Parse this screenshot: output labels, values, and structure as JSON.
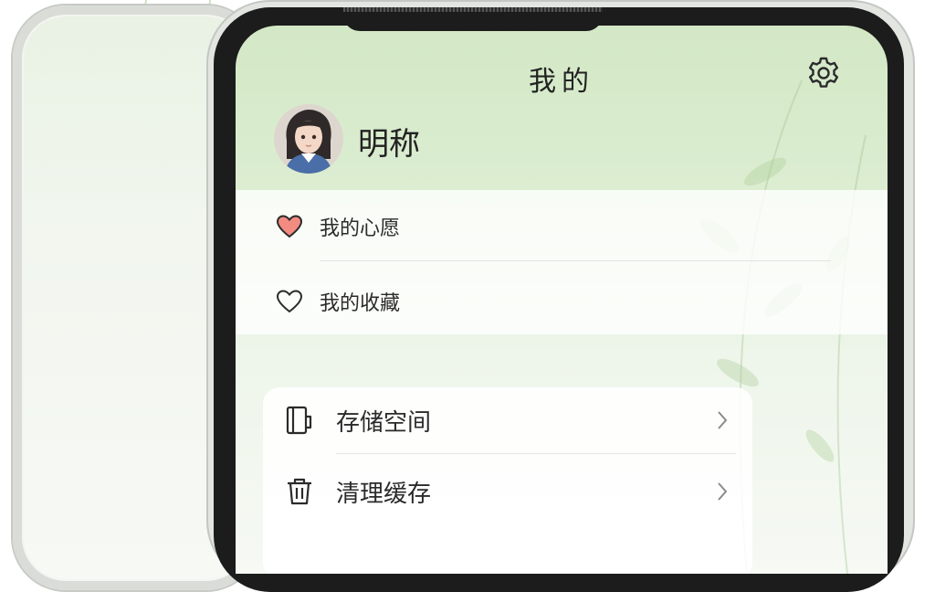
{
  "header": {
    "title": "我的",
    "settings_icon": "gear-icon"
  },
  "profile": {
    "name": "明称",
    "avatar": "avatar"
  },
  "menu": {
    "items": [
      {
        "label": "我的心愿",
        "icon": "heart-filled-icon",
        "color": "#f28b82"
      },
      {
        "label": "我的收藏",
        "icon": "heart-outline-icon"
      }
    ]
  },
  "settings_list": {
    "items": [
      {
        "label": "存储空间",
        "icon": "storage-icon"
      },
      {
        "label": "清理缓存",
        "icon": "trash-icon"
      }
    ]
  },
  "colors": {
    "accent_green": "#d3e8c6",
    "heart": "#f28b82",
    "text": "#222222"
  }
}
